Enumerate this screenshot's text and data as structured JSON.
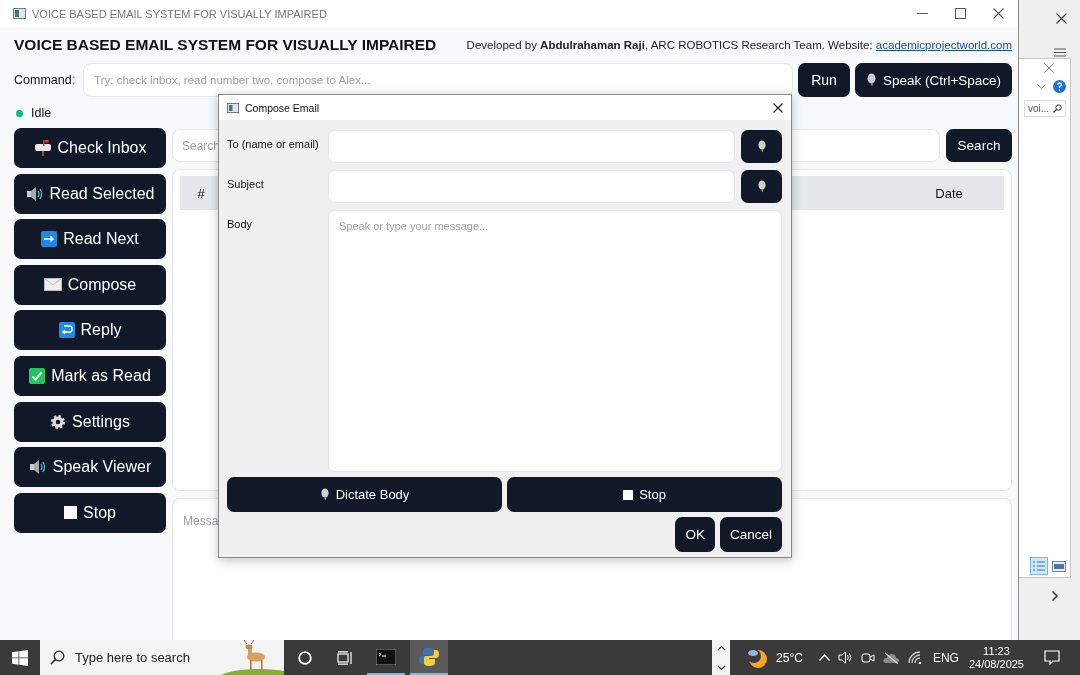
{
  "window": {
    "title": "VOICE BASED EMAIL SYSTEM FOR VISUALLY IMPAIRED"
  },
  "header": {
    "title": "VOICE BASED EMAIL SYSTEM FOR VISUALLY IMPAIRED",
    "credit": "Developed by **Abdulrahaman Raji**, ARC ROBOTICS Research Team. Website: ",
    "link": "academicprojectworld.com"
  },
  "command": {
    "label": "Command:",
    "placeholder": "Try: check inbox, read number two, compose to Alex...",
    "run_button": "Run",
    "speak_button": "Speak (Ctrl+Space)"
  },
  "status": {
    "text": "Idle"
  },
  "sidebar": {
    "buttons": [
      "Check Inbox",
      "Read Selected",
      "Read Next",
      "Compose",
      "Reply",
      "Mark as Read",
      "Settings",
      "Speak Viewer",
      "Stop"
    ]
  },
  "search": {
    "placeholder": "Search",
    "button": "Search"
  },
  "table": {
    "columns": [
      {
        "label": "#"
      },
      {
        "label": "Date"
      }
    ]
  },
  "viewer": {
    "placeholder": "Messa"
  },
  "dialog": {
    "title": "Compose Email",
    "fields": [
      {
        "kind": "line",
        "label": "To (name or email)"
      },
      {
        "kind": "line",
        "label": "Subject"
      },
      {
        "kind": "area",
        "label": "Body",
        "placeholder": "Speak or type your message..."
      }
    ],
    "dictate_button": "Dictate Body",
    "stop_button": "Stop",
    "ok_button": "OK",
    "cancel_button": "Cancel"
  },
  "background_window": {
    "search_text": "voi..."
  },
  "taskbar": {
    "search_placeholder": "Type here to search",
    "temperature": "25°C",
    "language": "ENG",
    "time": "11:23",
    "date": "24/08/2025"
  }
}
